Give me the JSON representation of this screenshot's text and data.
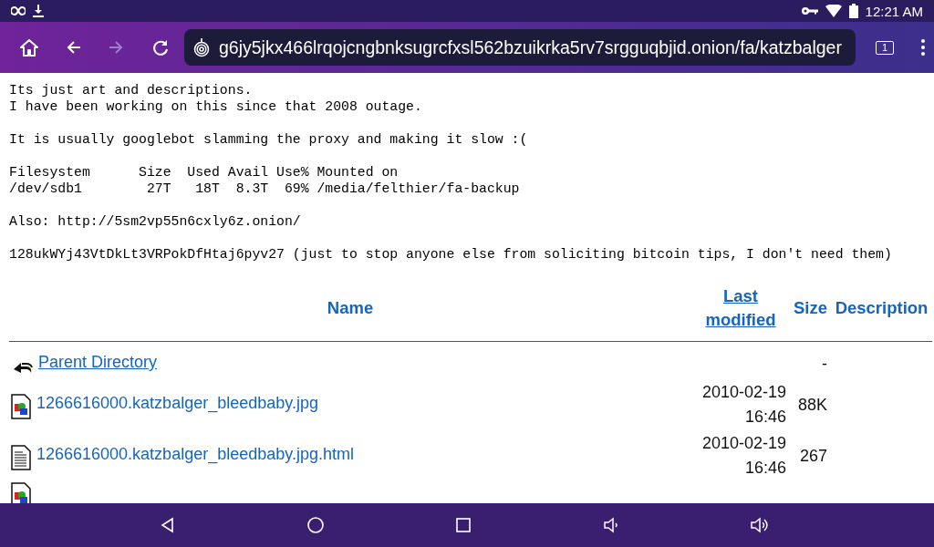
{
  "status_bar": {
    "time": "12:21 AM"
  },
  "toolbar": {
    "buttons": [
      {
        "kind": "home",
        "disabled": false
      },
      {
        "kind": "back",
        "disabled": false
      },
      {
        "kind": "forward",
        "disabled": true
      },
      {
        "kind": "reload",
        "disabled": false
      }
    ],
    "url": "g6jy5jkx466lrqojcngbnksugrcfxsl562bzuikrka5rv7srgguqbjid.onion/fa/katzbalger",
    "tab_count": "1"
  },
  "page": {
    "paragraphs": [
      [
        "Its just art and descriptions.",
        "I have been working on this since that 2008 outage."
      ],
      [
        "It is usually googlebot slamming the proxy and making it slow :("
      ],
      [
        "Filesystem      Size  Used Avail Use% Mounted on",
        "/dev/sdb1        27T   18T  8.3T  69% /media/felthier/fa-backup"
      ],
      [
        "Also: http://5sm2vp55n6cxly6z.onion/"
      ],
      [
        "128ukWYj43VtDkLt3VRPokDfHtaj6pyv27 (just to stop anyone else from soliciting bitcoin tips, I don't need them)"
      ]
    ],
    "table": {
      "columns": [
        {
          "label": "Name",
          "link": false
        },
        {
          "label": "Last modified",
          "link": true
        },
        {
          "label": "Size",
          "link": false
        },
        {
          "label": "Description",
          "link": false
        }
      ],
      "rows": [
        {
          "kind": "parent",
          "name": "Parent Directory",
          "size": "-"
        },
        {
          "kind": "image",
          "name": "1266616000.katzbalger_bleedbaby.jpg",
          "modified": "2010-02-19 16:46",
          "size": "88K"
        },
        {
          "kind": "text",
          "name": "1266616000.katzbalger_bleedbaby.jpg.html",
          "modified": "2010-02-19 16:46",
          "size": "267"
        },
        {
          "kind": "image"
        }
      ]
    }
  }
}
